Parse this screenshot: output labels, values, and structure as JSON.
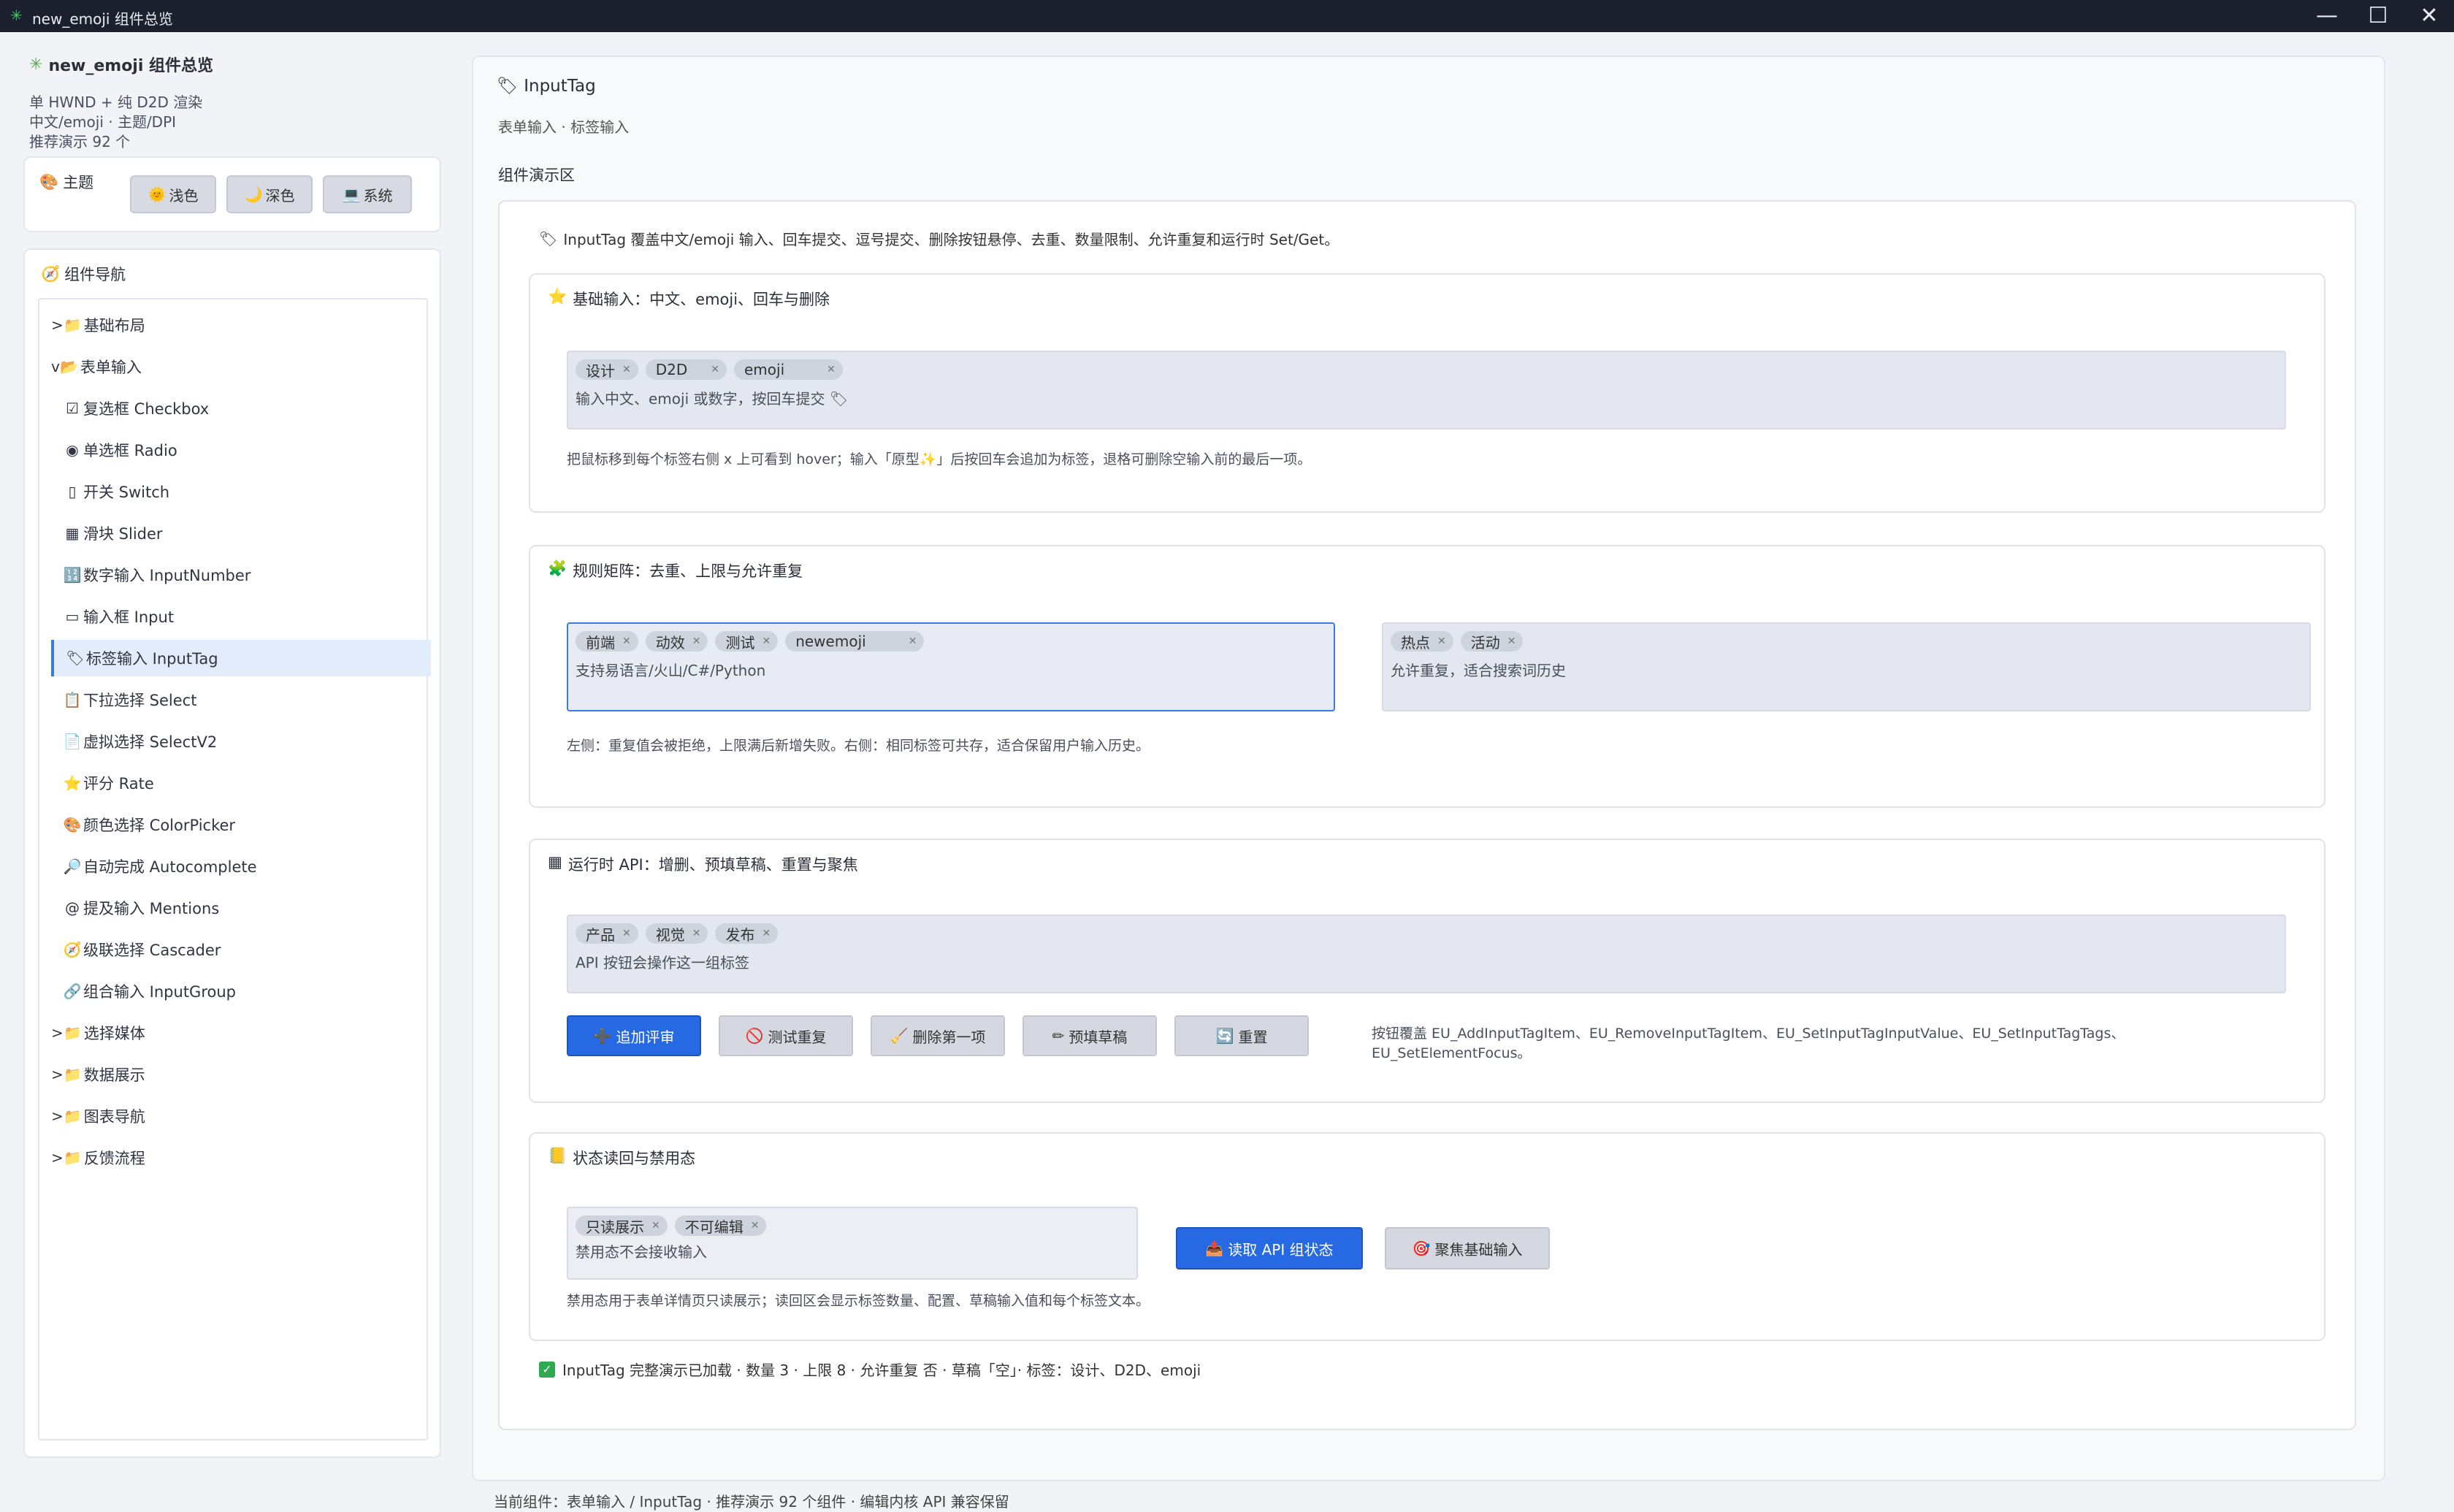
{
  "window": {
    "title": "new_emoji 组件总览",
    "minimize_glyph": "—",
    "maximize_glyph": "☐",
    "close_glyph": "✕"
  },
  "sidebar": {
    "app_title": "new_emoji 组件总览",
    "info_lines": [
      "单 HWND + 纯 D2D 渲染",
      "中文/emoji · 主题/DPI",
      "推荐演示 92 个"
    ],
    "theme": {
      "label": "主题",
      "buttons": [
        {
          "icon": "🌞",
          "label": "浅色"
        },
        {
          "icon": "🌙",
          "label": "深色"
        },
        {
          "icon": "💻",
          "label": "系统"
        }
      ]
    },
    "nav": {
      "label": "组件导航",
      "items": [
        {
          "icon": "📁",
          "label": ">基础布局",
          "prefix": ">",
          "text": "基础布局",
          "indent": 0
        },
        {
          "icon": "📂",
          "label": "v表单输入",
          "prefix": "v",
          "text": "表单输入",
          "indent": 0
        },
        {
          "icon": "☑",
          "text": "复选框 Checkbox",
          "indent": 1
        },
        {
          "icon": "◉",
          "text": "单选框 Radio",
          "indent": 1
        },
        {
          "icon": "▯",
          "text": "开关 Switch",
          "indent": 1
        },
        {
          "icon": "▦",
          "text": "滑块 Slider",
          "indent": 1
        },
        {
          "icon": "🔢",
          "text": "数字输入 InputNumber",
          "indent": 1
        },
        {
          "icon": "▭",
          "text": "输入框 Input",
          "indent": 1
        },
        {
          "icon": "🏷",
          "text": "标签输入 InputTag",
          "indent": 1,
          "active": true
        },
        {
          "icon": "📋",
          "text": "下拉选择 Select",
          "indent": 1
        },
        {
          "icon": "📄",
          "text": "虚拟选择 SelectV2",
          "indent": 1
        },
        {
          "icon": "⭐",
          "text": "评分 Rate",
          "indent": 1
        },
        {
          "icon": "🎨",
          "text": "颜色选择 ColorPicker",
          "indent": 1
        },
        {
          "icon": "🔎",
          "text": "自动完成 Autocomplete",
          "indent": 1
        },
        {
          "icon": "@",
          "text": "提及输入 Mentions",
          "indent": 1
        },
        {
          "icon": "🧭",
          "text": "级联选择 Cascader",
          "indent": 1
        },
        {
          "icon": "🔗",
          "text": "组合输入 InputGroup",
          "indent": 1
        },
        {
          "icon": "📁",
          "prefix": ">",
          "text": "选择媒体",
          "indent": 0
        },
        {
          "icon": "📁",
          "prefix": ">",
          "text": "数据展示",
          "indent": 0
        },
        {
          "icon": "📁",
          "prefix": ">",
          "text": "图表导航",
          "indent": 0
        },
        {
          "icon": "📁",
          "prefix": ">",
          "text": "反馈流程",
          "indent": 0
        }
      ]
    }
  },
  "main": {
    "title": "InputTag",
    "subtitle": "表单输入 · 标签输入",
    "demo_area_label": "组件演示区",
    "intro": "InputTag 覆盖中文/emoji 输入、回车提交、逗号提交、删除按钮悬停、去重、数量限制、允许重复和运行时 Set/Get。",
    "basic": {
      "title": "基础输入：中文、emoji、回车与删除",
      "tags": [
        "设计",
        "D2D",
        "emoji"
      ],
      "placeholder": "输入中文、emoji 或数字，按回车提交 🏷",
      "hint": "把鼠标移到每个标签右侧 x 上可看到 hover；输入「原型✨」后按回车会追加为标签，退格可删除空输入前的最后一项。"
    },
    "rules": {
      "title": "规则矩阵：去重、上限与允许重复",
      "left_tags": [
        "前端",
        "动效",
        "测试",
        "newemoji"
      ],
      "left_text": "支持易语言/火山/C#/Python",
      "right_tags": [
        "热点",
        "活动"
      ],
      "right_text": "允许重复，适合搜索词历史",
      "hint": "左侧：重复值会被拒绝，上限满后新增失败。右侧：相同标签可共存，适合保留用户输入历史。"
    },
    "api": {
      "title": "运行时 API：增删、预填草稿、重置与聚焦",
      "tags": [
        "产品",
        "视觉",
        "发布"
      ],
      "text": "API 按钮会操作这一组标签",
      "buttons": [
        {
          "icon": "➕",
          "label": "追加评审"
        },
        {
          "icon": "🚫",
          "label": "测试重复"
        },
        {
          "icon": "🧹",
          "label": "删除第一项"
        },
        {
          "icon": "✏",
          "label": "预填草稿"
        },
        {
          "icon": "🔄",
          "label": "重置"
        }
      ],
      "note_line1": "按钮覆盖 EU_AddInputTagItem、EU_RemoveInputTagItem、EU_SetInputTagInputValue、EU_SetInputTagTags、",
      "note_line2": "EU_SetElementFocus。"
    },
    "state": {
      "title": "状态读回与禁用态",
      "tags": [
        "只读展示",
        "不可编辑"
      ],
      "text": "禁用态不会接收输入",
      "read_button": {
        "icon": "📤",
        "label": "读取 API 组状态"
      },
      "focus_button": {
        "icon": "🎯",
        "label": "聚焦基础输入"
      },
      "hint": "禁用态用于表单详情页只读展示；读回区会显示标签数量、配置、草稿输入值和每个标签文本。"
    },
    "status_line": "InputTag 完整演示已加载 · 数量 3 · 上限 8 · 允许重复 否 · 草稿「空」· 标签：设计、D2D、emoji",
    "footer": "当前组件：表单输入 / InputTag · 推荐演示 92 个组件 · 编辑内核 API 兼容保留"
  },
  "colors": {
    "accent": "#2669e3",
    "titlebar": "#1b1f2e",
    "status_ok": "#2fa84f"
  }
}
